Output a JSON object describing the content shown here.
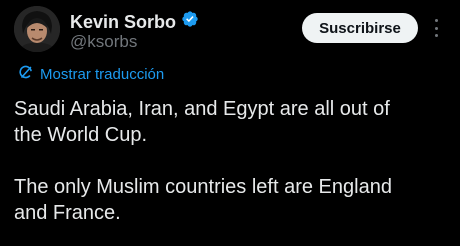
{
  "user": {
    "display_name": "Kevin Sorbo",
    "handle": "@ksorbs",
    "verified_icon": "verified-badge-icon",
    "verified_color": "#1d9bf0"
  },
  "actions": {
    "subscribe_label": "Suscribirse",
    "more_icon": "more-vertical-icon"
  },
  "translation": {
    "icon": "translate-icon",
    "label": "Mostrar traducción"
  },
  "tweet": {
    "text": "Saudi Arabia, Iran, and Egypt are all out of\nthe World Cup.\n\nThe only Muslim countries left are England\nand France."
  },
  "colors": {
    "background": "#000000",
    "accent": "#1d9bf0",
    "text": "#e7e9ea",
    "secondary_text": "#71767b",
    "button_bg": "#eff3f4"
  }
}
